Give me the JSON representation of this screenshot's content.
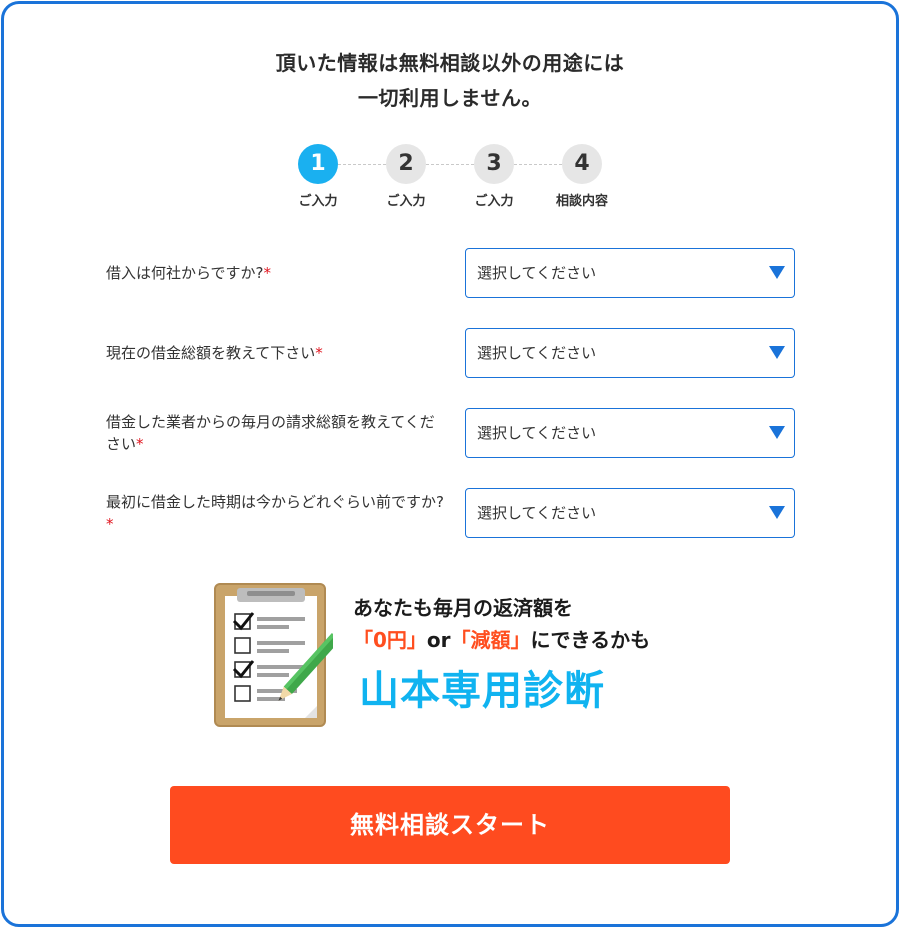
{
  "notice": {
    "line1": "頂いた情報は無料相談以外の用途には",
    "line2": "一切利用しません。"
  },
  "steps": [
    {
      "number": "1",
      "label": "ご入力",
      "active": true
    },
    {
      "number": "2",
      "label": "ご入力",
      "active": false
    },
    {
      "number": "3",
      "label": "ご入力",
      "active": false
    },
    {
      "number": "4",
      "label": "相談内容",
      "active": false
    }
  ],
  "questions": [
    {
      "label": "借入は何社からですか?",
      "required_mark": "*",
      "select_value": "選択してください"
    },
    {
      "label": "現在の借金総額を教えて下さい",
      "required_mark": "*",
      "select_value": "選択してください"
    },
    {
      "label": "借金した業者からの毎月の請求総額を教えてください",
      "required_mark": "*",
      "select_value": "選択してください"
    },
    {
      "label": "最初に借金した時期は今からどれぐらい前ですか?",
      "required_mark": "*",
      "select_value": "選択してください"
    }
  ],
  "banner": {
    "line1": "あなたも毎月の返済額を",
    "highlight1": "「0円」",
    "connector": "or",
    "highlight2": "「減額」",
    "line2_tail": "にできるかも",
    "line3": "山本専用診断",
    "icon": "clipboard-checklist-icon"
  },
  "start_button": {
    "label": "無料相談スタート"
  },
  "colors": {
    "frame_border": "#1a73d9",
    "active_step": "#1ab0f0",
    "inactive_step": "#e6e6e6",
    "required": "#e0141e",
    "cta": "#ff4b1f",
    "highlight": "#ff4e1f",
    "diagnosis": "#10b3f0"
  }
}
